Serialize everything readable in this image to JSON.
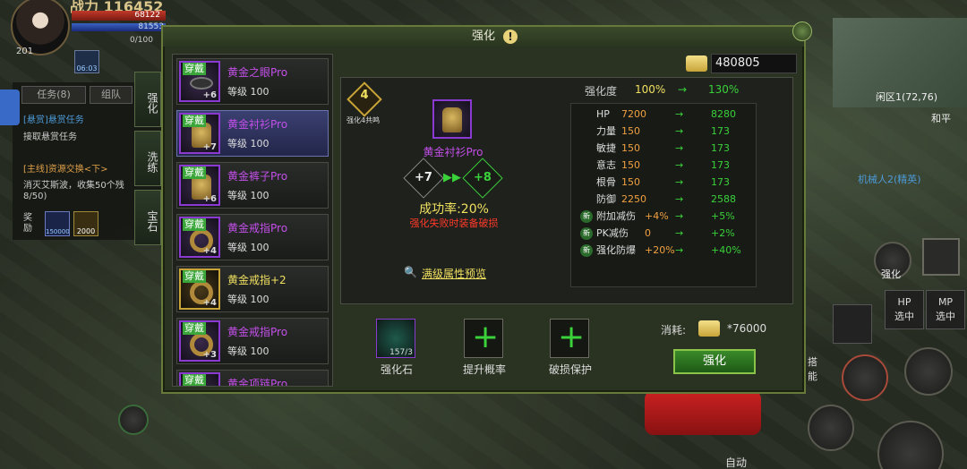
{
  "hud": {
    "power": "战力 116452",
    "hp_value": "68122",
    "mp_value": "81553",
    "mp_sub": "0/100",
    "level": "201",
    "buff_time": "06:03"
  },
  "quest": {
    "tab_tasks": "任务(8)",
    "tab_team": "组队",
    "line1": "[悬赏]悬赏任务",
    "line2": "接取悬赏任务",
    "line3": "[主线]资源交换<下>",
    "line4": "消灭艾斯波，收集50个残",
    "line5": "8/50)",
    "reward_label": "奖励",
    "reward_exp": "1500000",
    "reward_gold": "2000"
  },
  "sidetabs": {
    "enhance": "强化",
    "refine": "洗练",
    "gem": "宝石"
  },
  "world": {
    "coord": "闲区1(72,76)",
    "peace": "和平",
    "npc": "机械人2(精英)",
    "enhance_shortcut": "强化",
    "hp_select": [
      "HP",
      "选中"
    ],
    "mp_select": [
      "MP",
      "选中"
    ],
    "skill_label": "搭能",
    "auto": "自动"
  },
  "dialog": {
    "title": "强化",
    "currency": "480805",
    "items": [
      {
        "tag": "穿戴",
        "name": "黄金之眼Pro",
        "level": "等级 100",
        "plus": "+6",
        "kind": "purple"
      },
      {
        "tag": "穿戴",
        "name": "黄金衬衫Pro",
        "level": "等级 100",
        "plus": "+7",
        "kind": "purple"
      },
      {
        "tag": "穿戴",
        "name": "黄金裤子Pro",
        "level": "等级 100",
        "plus": "+6",
        "kind": "purple"
      },
      {
        "tag": "穿戴",
        "name": "黄金戒指Pro",
        "level": "等级 100",
        "plus": "+4",
        "kind": "purple"
      },
      {
        "tag": "穿戴",
        "name": "黄金戒指+2",
        "level": "等级 100",
        "plus": "+4",
        "kind": "gold"
      },
      {
        "tag": "穿戴",
        "name": "黄金戒指Pro",
        "level": "等级 100",
        "plus": "+3",
        "kind": "purple"
      },
      {
        "tag": "穿戴",
        "name": "黄金项链Pro",
        "level": "",
        "plus": "",
        "kind": "purple"
      }
    ],
    "badge_num": "4",
    "badge_label": "强化4共鸣",
    "selected_name": "黄金衬衫Pro",
    "from_level": "+7",
    "to_level": "+8",
    "success_rate": "成功率:20%",
    "fail_warning": "强化失败时装备破损",
    "preview": "满级属性预览",
    "enhance_label": "强化度",
    "enhance_from": "100%",
    "enhance_to": "130%",
    "attrs": [
      {
        "name": "HP",
        "from": "7200",
        "to": "8280"
      },
      {
        "name": "力量",
        "from": "150",
        "to": "173"
      },
      {
        "name": "敏捷",
        "from": "150",
        "to": "173"
      },
      {
        "name": "意志",
        "from": "150",
        "to": "173"
      },
      {
        "name": "根骨",
        "from": "150",
        "to": "173"
      },
      {
        "name": "防御",
        "from": "2250",
        "to": "2588"
      },
      {
        "name": "附加减伤",
        "from": "+4%",
        "to": "+5%",
        "new": "新"
      },
      {
        "name": "PK减伤",
        "from": "0",
        "to": "+2%",
        "new": "新"
      },
      {
        "name": "强化防爆",
        "from": "+20%",
        "to": "+40%",
        "new": "新"
      }
    ],
    "arrow": "→",
    "slot_stone": "强化石",
    "slot_stone_count": "157/3",
    "slot_rate": "提升概率",
    "slot_protect": "破损保护",
    "cost_label": "消耗:",
    "cost_value": "*76000",
    "enhance_button": "强化"
  },
  "colors": {
    "accent_green": "#3ad13a",
    "purple_name": "#c34fe8",
    "gold_name": "#f0e060",
    "warning_red": "#ff3a2a"
  }
}
